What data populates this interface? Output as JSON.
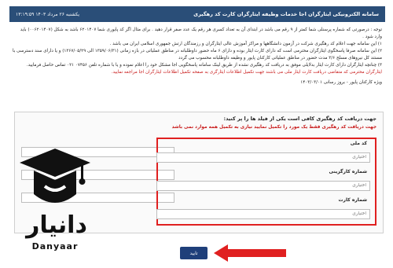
{
  "header": {
    "title": "سامانه الکترونیکی ایثارگران اجا   خدمات   وظیفه   ایثارگران   کارت   کد رهگیری",
    "date": "یکشنبه ۲۶ مرداد ۱۴۰۳   ۱۳:۱۹:۵۹"
  },
  "notice": {
    "p1": "توجه : درصورتی که شماره پرسنلی شما کمتر از ۹ رقم می باشد در ابتدای آن به تعداد کسری هر رقم یک عدد صفر قرار دهید . برای مثال اگر کد پایوری شما ۶۲۰۱۴۰۷ باشد به شکل (۰۰۶۲۰۱۴۰۷) باید وارد شود .",
    "p2": "۱) این سامانه جهت اعلام کد رهگیری شرکت در آزمون دانشگاهها و مراکز آموزش عالی ایثارگران و رزمندگان ارتش جمهوری اسلامی ایران می باشد .",
    "p3": "۲) این سامانه صرفا پاسخگوی ایثارگران محترمی است که دارای کارت ایثار بوده و دارای ۶ ماه حضور داوطلبانه در مناطق عملیاتی در بازه زمانی (۱۳۵۹/۰۶/۳۱ الی ۱۳۶۷/۰۵/۲۹) و یا دارای سند دسترسی با مستند کل نیروهای مسلح ۳/۶ مدت حضور در مناطق عملیاتی کارکنان پایور و وظیفه داوطلبانه محسوب می گردد",
    "p4": "۳) چنانچه ایثارگران دارای کارت ایثار بدلایلی موفق به دریافت کد رهگیری نشده از طریق لینک سامانه پاسخگویی اجا مشکل خود را اعلام نموده و یا با شماره تلفن ۰۷۴۵۶ ۰۲۱ تماس حاصل فرمایید.",
    "p5": "ایثارگران محترمی که متقاضی دریافت کارت ایثار ملی می باشند جهت تکمیل اطلاعات ایثارگری به صفحه تکمیل اطلاعات ایثارگران اجا مراجعه نمایید."
  },
  "deadline": {
    "line1": "ویژه کارکنان پایور - بروز رسانی ۱۴۰۳/۰۳/۰۱"
  },
  "form": {
    "heading": "جهت دریافت کد رهگیری کافی است یکی از فیلد ها را پر کنید:",
    "warning": "جهت دریافت کد رهگیری فقط یک مورد را تکمیل نمایید نیازی به تکمیل همه موارد نمی باشد",
    "national_code_label": "کد ملی",
    "national_code_placeholder": "اختیاری",
    "personnel_label": "شماره کارگزینی",
    "personnel_placeholder": "اختیاری",
    "card_label": "شماره کارت",
    "card_placeholder": "اختیاری",
    "submit_label": "تایید"
  },
  "logo": {
    "name": "دانیار",
    "latin": "Danyaar"
  },
  "colors": {
    "header_bg": "#2a4e78",
    "alert_red": "#e02020",
    "button_bg": "#1f3f7a"
  }
}
